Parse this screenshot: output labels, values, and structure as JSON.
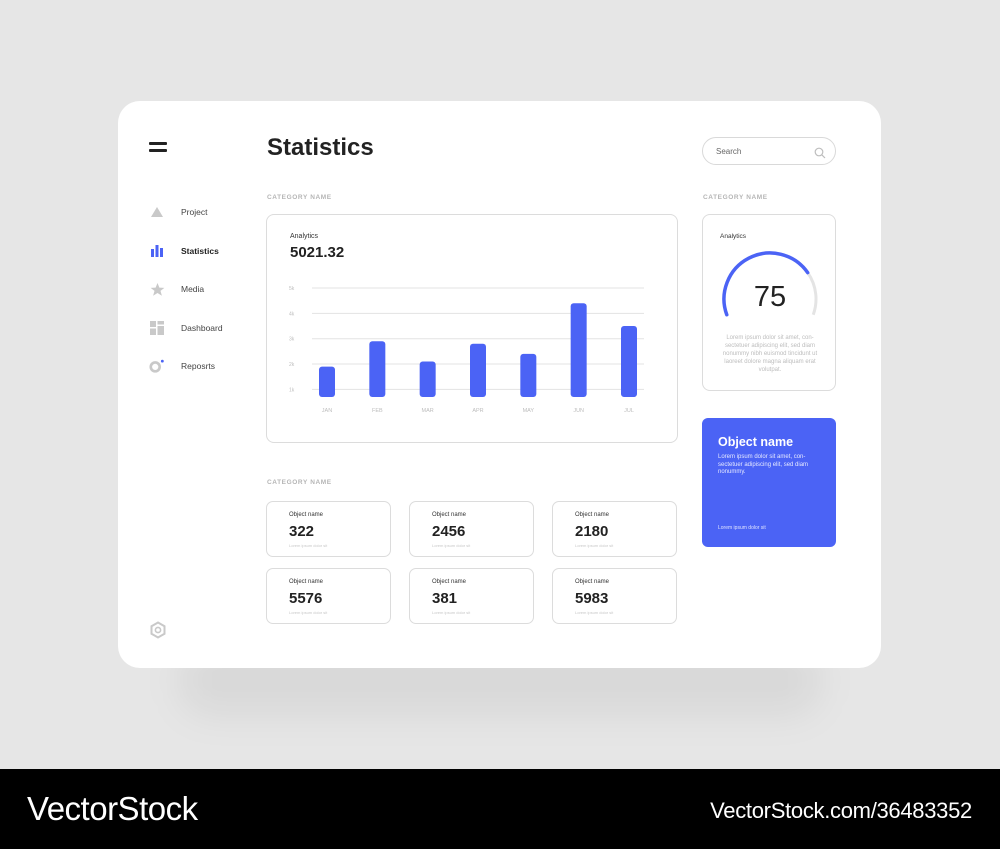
{
  "page": {
    "title": "Statistics"
  },
  "search": {
    "placeholder": "Search"
  },
  "sidebar": {
    "items": [
      {
        "label": "Project",
        "icon": "triangle-icon",
        "active": false
      },
      {
        "label": "Statistics",
        "icon": "bar-chart-icon",
        "active": true
      },
      {
        "label": "Media",
        "icon": "star-icon",
        "active": false
      },
      {
        "label": "Dashboard",
        "icon": "dashboard-icon",
        "active": false
      },
      {
        "label": "Reposrts",
        "icon": "reports-icon",
        "active": false
      }
    ]
  },
  "sections": {
    "chart_category": "CATEGORY NAME",
    "side_category": "CATEGORY NAME",
    "objects_category": "CATEGORY NAME"
  },
  "analytics_card": {
    "subtitle": "Analytics",
    "value": "5021.32"
  },
  "chart_data": {
    "type": "bar",
    "categories": [
      "JAN",
      "FEB",
      "MAR",
      "APR",
      "MAY",
      "JUN",
      "JUL"
    ],
    "values": [
      1.9,
      2.9,
      2.1,
      2.8,
      2.4,
      4.4,
      3.5
    ],
    "y_ticks": [
      "1k",
      "2k",
      "3k",
      "4k",
      "5k"
    ],
    "ylim": [
      0.7,
      5
    ],
    "grid": true,
    "bar_color": "#4b63f5"
  },
  "gauge_card": {
    "subtitle": "Analytics",
    "value": "75",
    "percent": 75,
    "description": "Lorem ipsum dolor sit amet, con- sectetuer adipiscing elit, sed diam nonummy nibh euismod tincidunt ut laoreet dolore magna aliquam erat volutpat.",
    "accent": "#4b63f5"
  },
  "promo_card": {
    "title": "Object name",
    "description": "Lorem ipsum dolor sit amet, con- sectetuer adipiscing elit, sed diam nonummy.",
    "footer": "Lorem ipsum dolor sit",
    "color": "#4b63f5"
  },
  "objects": [
    {
      "name": "Object name",
      "value": "322",
      "sub": "Lorem ipsum dolor sit"
    },
    {
      "name": "Object name",
      "value": "2456",
      "sub": "Lorem ipsum dolor sit"
    },
    {
      "name": "Object name",
      "value": "2180",
      "sub": "Lorem ipsum dolor sit"
    },
    {
      "name": "Object name",
      "value": "5576",
      "sub": "Lorem ipsum dolor sit"
    },
    {
      "name": "Object name",
      "value": "381",
      "sub": "Lorem ipsum dolor sit"
    },
    {
      "name": "Object name",
      "value": "5983",
      "sub": "Lorem ipsum dolor sit"
    }
  ],
  "footer": {
    "brand": "VectorStock",
    "url": "VectorStock.com/36483352"
  }
}
